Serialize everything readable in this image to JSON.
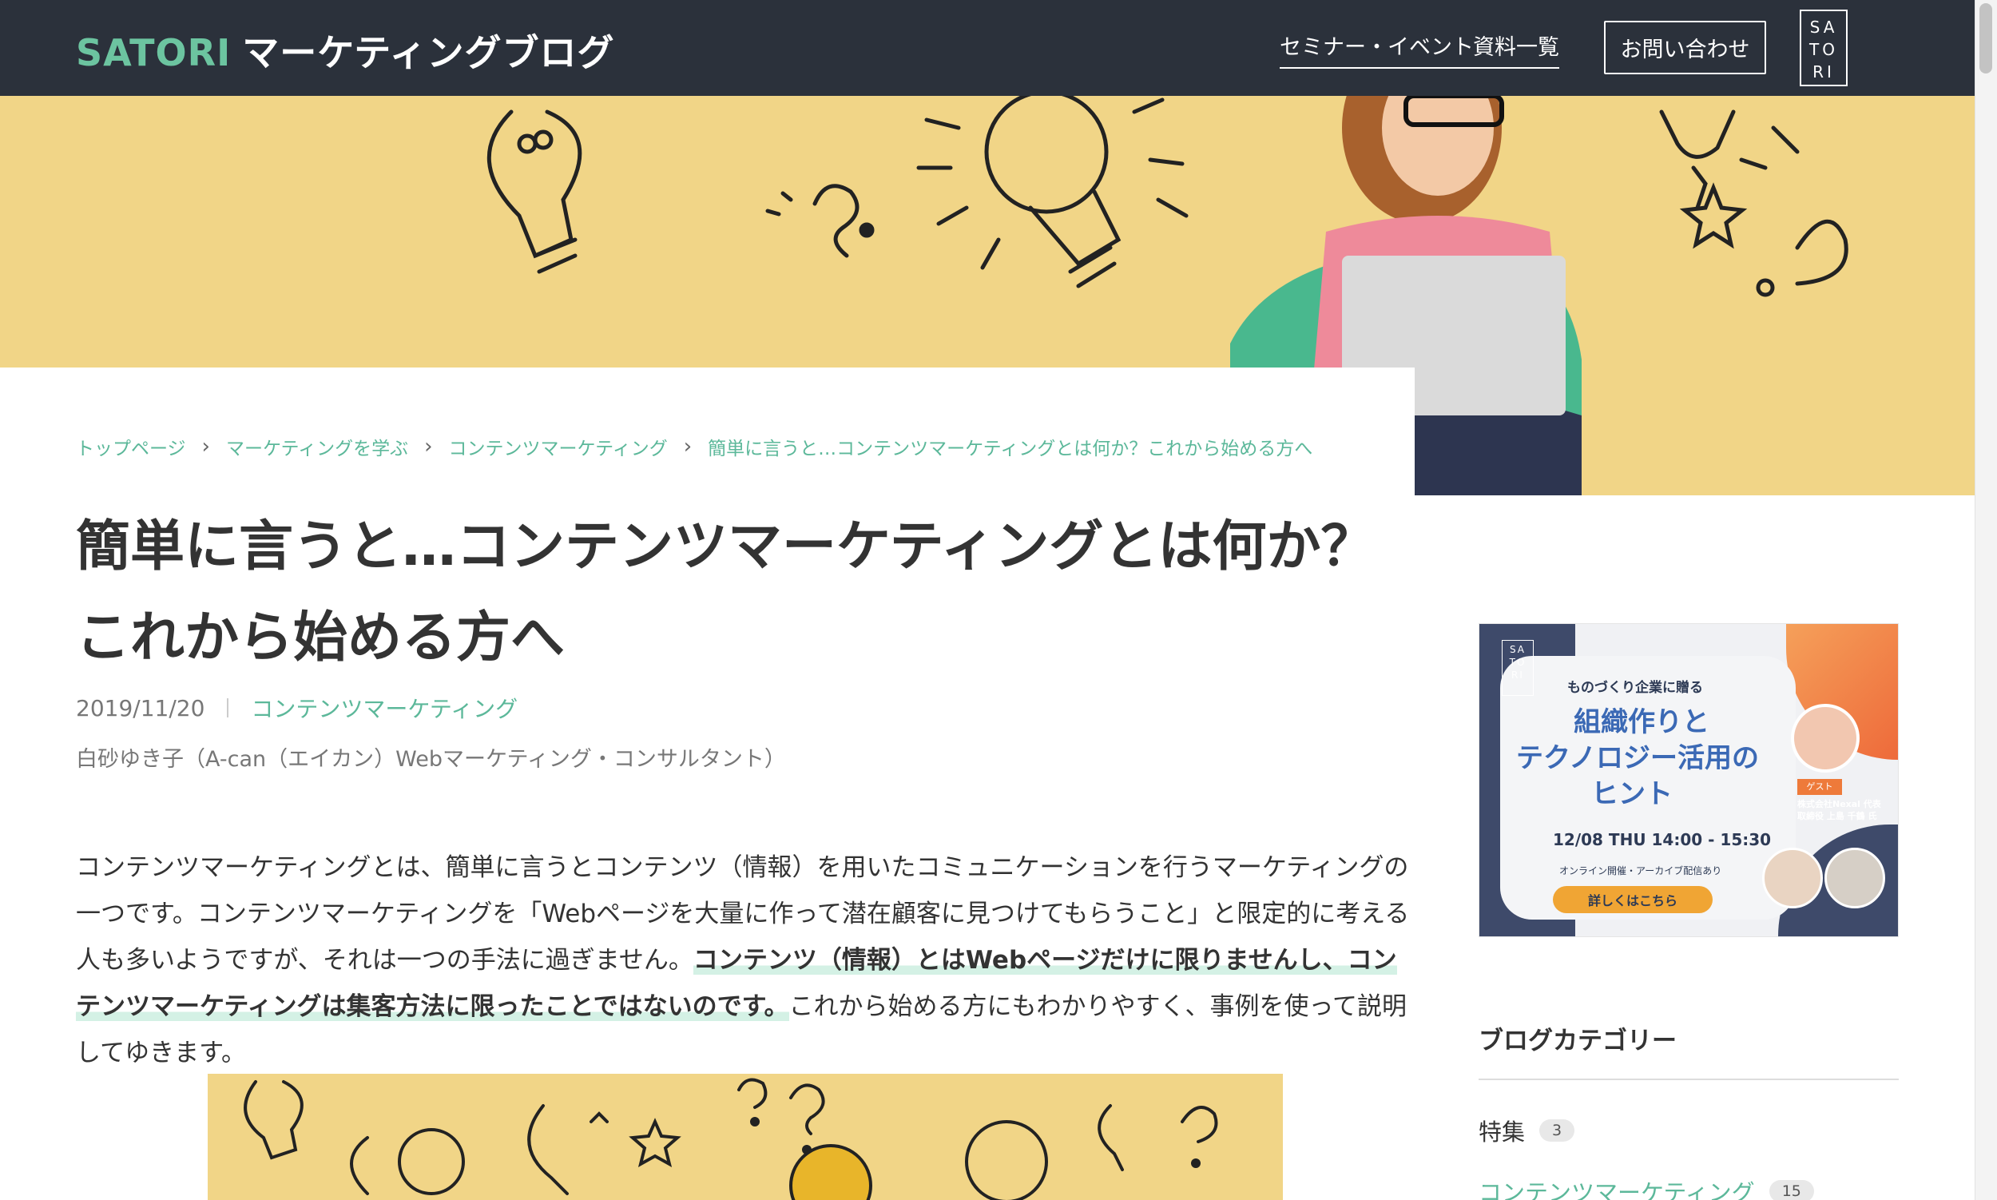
{
  "header": {
    "brand": "SATORI",
    "blog_title": "マーケティングブログ",
    "nav": [
      "セミナー・イベント",
      "資料一覧"
    ],
    "contact": "お問い合わせ",
    "logo_lines": [
      "SA",
      "TO",
      "RI"
    ]
  },
  "breadcrumb": [
    "トップページ",
    "マーケティングを学ぶ",
    "コンテンツマーケティング",
    "簡単に言うと…コンテンツマーケティングとは何か？これから始める方へ"
  ],
  "article": {
    "title_line1": "簡単に言うと…コンテンツマーケティングとは何か？",
    "title_line2": "これから始める方へ",
    "date": "2019/11/20",
    "category": "コンテンツマーケティング",
    "author": "白砂ゆき子（A-can（エイカン）Webマーケティング・コンサルタント）",
    "para_a": "コンテンツマーケティングとは、簡単に言うとコンテンツ（情報）を用いたコミュニケーションを行うマーケティングの一つです。コンテンツマーケティングを「Webページを大量に作って潜在顧客に見つけてもらうこと」と限定的に考える人も多いようですが、それは一つの手法に過ぎません。",
    "para_b": "コンテンツ（情報）とはWebページだけに限りませんし、コンテンツマーケティングは集客方法に限ったことではないのです。",
    "para_c": "これから始める方にもわかりやすく、事例を使って説明してゆきます。"
  },
  "banner": {
    "logo_lines": [
      "SA",
      "TO",
      "RI"
    ],
    "subtitle": "ものづくり企業に贈る",
    "title1": "組織作りと",
    "title2": "テクノロジー活用の",
    "title3": "ヒント",
    "date": "12/08 THU 14:00 - 15:30",
    "online": "オンライン開催・アーカイブ配信あり",
    "button": "詳しくはこちら",
    "guest_label": "ゲスト",
    "guest_name": "株式会社Nexal 代表取締役 上島 千鶴 氏"
  },
  "sidebar": {
    "heading": "ブログカテゴリー",
    "categories": [
      {
        "name": "特集",
        "count": "3"
      },
      {
        "name": "コンテンツマーケティング",
        "count": "15"
      }
    ]
  },
  "colors": {
    "header_bg": "#2b313b",
    "accent_green": "#5cb89a",
    "hero_yellow": "#f1d587"
  }
}
